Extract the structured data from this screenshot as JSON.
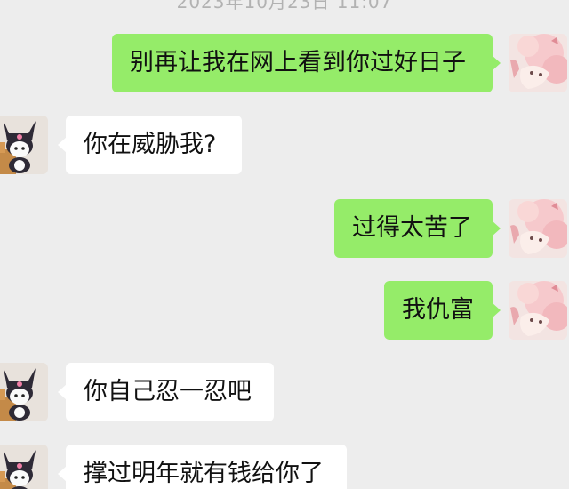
{
  "chat": {
    "timestamp": "2023年10月23日 11:07",
    "messages": [
      {
        "sender": "self",
        "text": "别再让我在网上看到你过好日子"
      },
      {
        "sender": "other",
        "text": "你在威胁我?"
      },
      {
        "sender": "self",
        "text": "过得太苦了"
      },
      {
        "sender": "self",
        "text": "我仇富"
      },
      {
        "sender": "other",
        "text": "你自己忍一忍吧"
      },
      {
        "sender": "other",
        "text": "撑过明年就有钱给你了"
      }
    ]
  },
  "colors": {
    "background": "#ededed",
    "self_bubble": "#95ec69",
    "other_bubble": "#ffffff",
    "timestamp_text": "#b2b2b2"
  },
  "icons": {
    "self_avatar": "pink-anime-girl-avatar",
    "other_avatar": "kuromi-avatar"
  }
}
